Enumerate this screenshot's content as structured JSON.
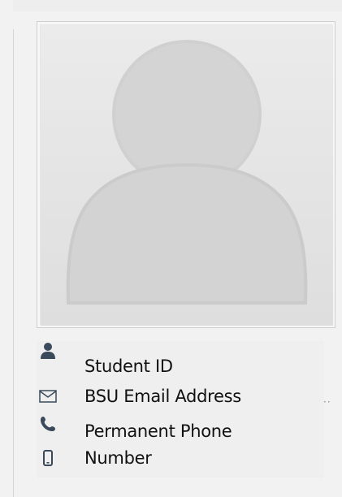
{
  "profile": {
    "avatar_label": "",
    "fields": [
      {
        "label": "Student ID",
        "icon": "person-icon"
      },
      {
        "label": "BSU Email Address",
        "icon": "mail-icon"
      },
      {
        "label": "Permanent Phone",
        "icon": "phone-icon"
      },
      {
        "label": "Number",
        "icon": "mobile-icon"
      }
    ],
    "more_marker": "··"
  },
  "colors": {
    "background": "#f2f2f2",
    "avatar_fill": "#d3d3d3",
    "icon_color": "#3a4a5a"
  }
}
